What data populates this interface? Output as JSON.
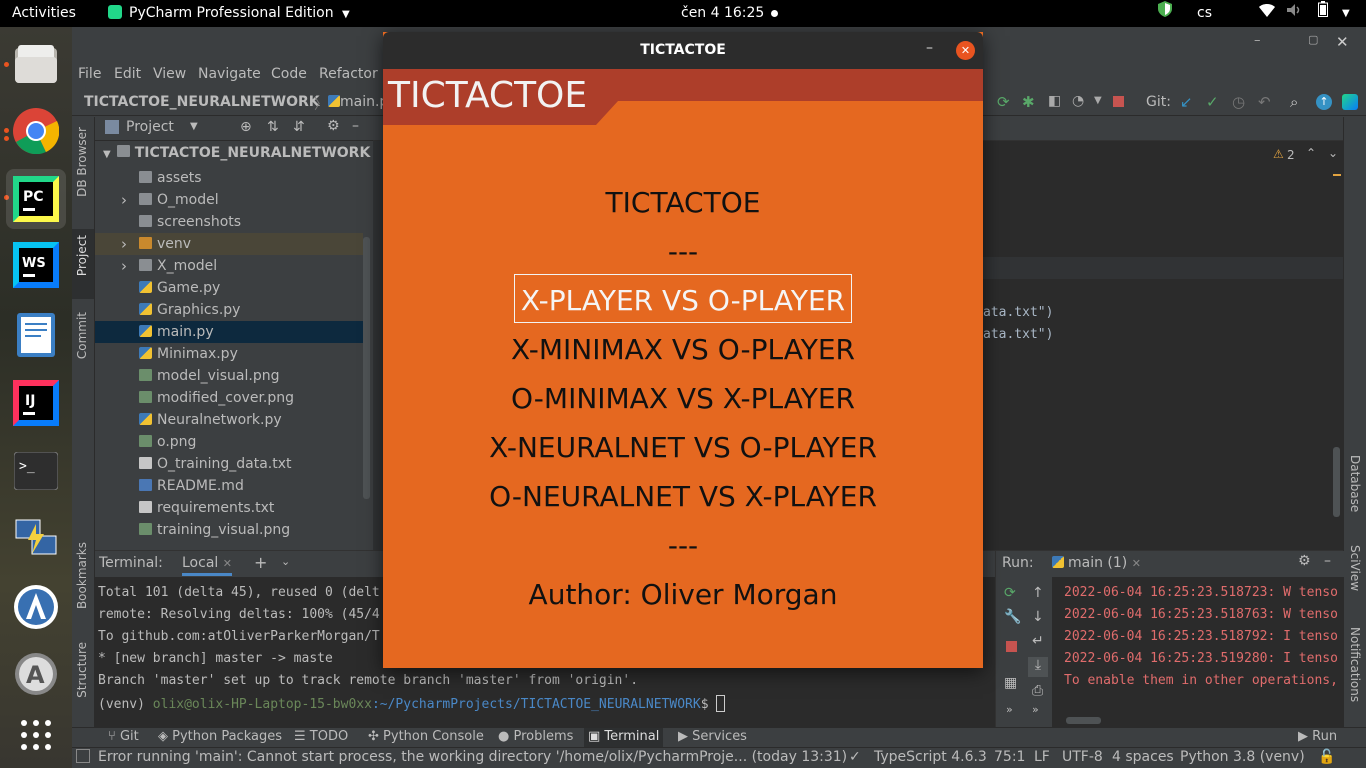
{
  "topbar": {
    "activities": "Activities",
    "app_name": "PyCharm Professional Edition",
    "datetime": "čen 4  16:25",
    "lang": "cs"
  },
  "dock": {
    "items": [
      "files-app",
      "chrome",
      "pycharm",
      "webstorm",
      "text-editor",
      "intellij",
      "terminal",
      "network-manager",
      "android-studio",
      "software-updater",
      "show-apps"
    ]
  },
  "ide": {
    "menu": [
      "File",
      "Edit",
      "View",
      "Navigate",
      "Code",
      "Refactor"
    ],
    "breadcrumb": {
      "project": "TICTACTOE_NEURALNETWORK",
      "file": "main.py"
    },
    "git_label": "Git:",
    "left_strip": [
      "DB Browser",
      "Project",
      "Commit",
      "Bookmarks",
      "Structure"
    ],
    "right_strip": [
      "Database",
      "SciView",
      "Notifications"
    ],
    "project_panel": {
      "title": "Project",
      "root": "TICTACTOE_NEURALNETWORK",
      "items": [
        {
          "name": "assets",
          "type": "folder"
        },
        {
          "name": "O_model",
          "type": "folder"
        },
        {
          "name": "screenshots",
          "type": "folder"
        },
        {
          "name": "venv",
          "type": "folder"
        },
        {
          "name": "X_model",
          "type": "folder"
        },
        {
          "name": "Game.py",
          "type": "py"
        },
        {
          "name": "Graphics.py",
          "type": "py"
        },
        {
          "name": "main.py",
          "type": "py"
        },
        {
          "name": "Minimax.py",
          "type": "py"
        },
        {
          "name": "model_visual.png",
          "type": "img"
        },
        {
          "name": "modified_cover.png",
          "type": "img"
        },
        {
          "name": "Neuralnetwork.py",
          "type": "py"
        },
        {
          "name": "o.png",
          "type": "img"
        },
        {
          "name": "O_training_data.txt",
          "type": "txt"
        },
        {
          "name": "README.md",
          "type": "md"
        },
        {
          "name": "requirements.txt",
          "type": "txt"
        },
        {
          "name": "training_visual.png",
          "type": "img"
        }
      ]
    },
    "editor": {
      "warnings": "2",
      "code_lines": [
        "ata.txt\")",
        "ata.txt\")"
      ]
    },
    "terminal": {
      "title": "Terminal:",
      "tab": "Local",
      "lines": [
        "Total 101 (delta 45), reused 0 (delt",
        "remote: Resolving deltas: 100% (45/4",
        "To github.com:atOliverParkerMorgan/T",
        " * [new branch]      master -> maste",
        "Branch 'master' set up to track remote branch 'master' from 'origin'."
      ],
      "prompt_env": "(venv) ",
      "prompt_user": "olix@olix-HP-Laptop-15-bw0xx",
      "prompt_path": ":~/PycharmProjects/TICTACTOE_NEURALNETWORK",
      "prompt_end": "$ "
    },
    "run": {
      "title": "Run:",
      "tab": "main (1)",
      "lines": [
        "2022-06-04 16:25:23.518723: W tenso",
        "2022-06-04 16:25:23.518763: W tenso",
        "2022-06-04 16:25:23.518792: I tenso",
        "2022-06-04 16:25:23.519280: I tenso",
        "To enable them in other operations,"
      ]
    },
    "bottom_tabs": [
      "Git",
      "Python Packages",
      "TODO",
      "Python Console",
      "Problems",
      "Terminal",
      "Services"
    ],
    "run_button": "Run",
    "status": {
      "message": "Error running 'main': Cannot start process, the working directory '/home/olix/PycharmProje... (today 13:31)",
      "typescript": "TypeScript 4.6.3",
      "position": "75:1",
      "line_sep": "LF",
      "encoding": "UTF-8",
      "indent": "4 spaces",
      "interpreter": "Python 3.8 (venv)"
    }
  },
  "game_window": {
    "titlebar": "TICTACTOE",
    "header": "TICTACTOE",
    "menu": [
      "TICTACTOE",
      "---",
      "X-PLAYER VS O-PLAYER",
      "X-MINIMAX VS O-PLAYER",
      "O-MINIMAX VS X-PLAYER",
      "X-NEURALNET VS O-PLAYER",
      "O-NEURALNET VS X-PLAYER",
      "---",
      "Author: Oliver Morgan"
    ],
    "selected_index": 2
  }
}
